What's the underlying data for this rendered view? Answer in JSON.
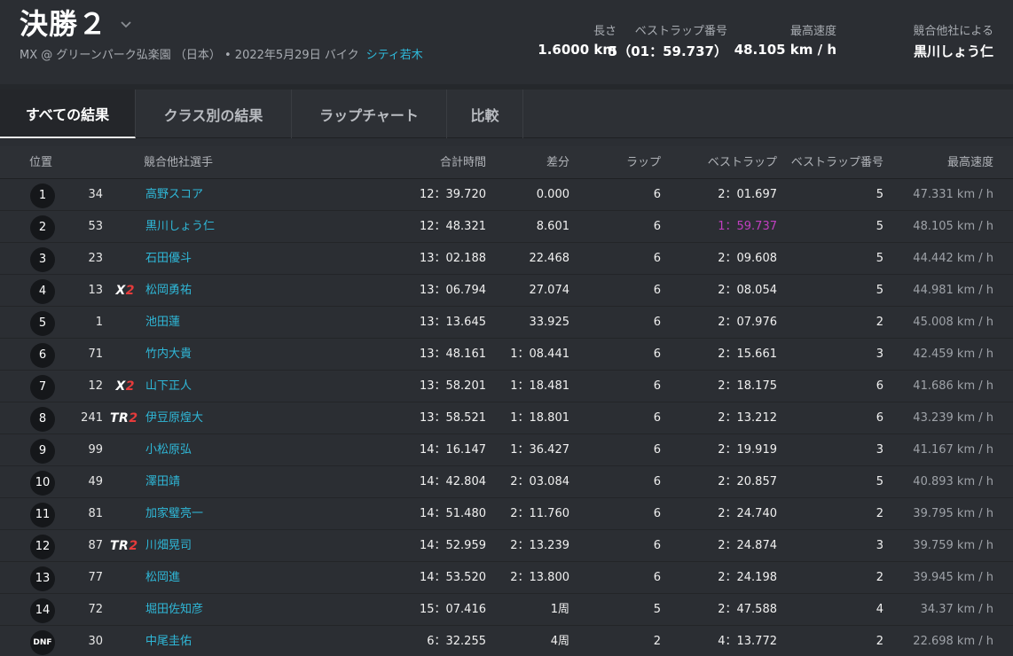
{
  "header": {
    "title": "決勝２",
    "subtitle_info": "MX @ グリーンパーク弘楽園 （日本） • 2022年5月29日 バイク",
    "subtitle_link": "シティ若木",
    "stats": [
      {
        "label": "長さ",
        "value": "1.6000 km"
      },
      {
        "label": "ベストラップ番号",
        "value": "5（01：59.737）"
      },
      {
        "label": "最高速度",
        "value": "48.105 km / h"
      },
      {
        "label": "競合他社による",
        "value": "黒川しょう仁"
      }
    ]
  },
  "tabs": [
    "すべての結果",
    "クラス別の結果",
    "ラップチャート",
    "比較"
  ],
  "columns": {
    "pos": "位置",
    "rider": "競合他社選手",
    "total": "合計時間",
    "gap": "差分",
    "laps": "ラップ",
    "best": "ベストラップ",
    "best_no": "ベストラップ番号",
    "speed": "最高速度"
  },
  "colors": {
    "accent": "#2fb8d8",
    "best_lap_highlight": "#c03fc0",
    "class_badge_number": "#e63b3b"
  },
  "rows": [
    {
      "pos": "1",
      "num": "34",
      "cls": "",
      "cls_n": "",
      "name": "高野スコア",
      "total": "12：39.720",
      "gap": "0.000",
      "laps": "6",
      "best": "2：01.697",
      "best_no": "5",
      "speed": "47.331 km / h"
    },
    {
      "pos": "2",
      "num": "53",
      "cls": "",
      "cls_n": "",
      "name": "黒川しょう仁",
      "total": "12：48.321",
      "gap": "8.601",
      "laps": "6",
      "best": "1：59.737",
      "best_no": "5",
      "speed": "48.105 km / h"
    },
    {
      "pos": "3",
      "num": "23",
      "cls": "",
      "cls_n": "",
      "name": "石田優斗",
      "total": "13：02.188",
      "gap": "22.468",
      "laps": "6",
      "best": "2：09.608",
      "best_no": "5",
      "speed": "44.442 km / h"
    },
    {
      "pos": "4",
      "num": "13",
      "cls": "X",
      "cls_n": "2",
      "name": "松岡勇祐",
      "total": "13：06.794",
      "gap": "27.074",
      "laps": "6",
      "best": "2：08.054",
      "best_no": "5",
      "speed": "44.981 km / h"
    },
    {
      "pos": "5",
      "num": "1",
      "cls": "",
      "cls_n": "",
      "name": "池田蓮",
      "total": "13：13.645",
      "gap": "33.925",
      "laps": "6",
      "best": "2：07.976",
      "best_no": "2",
      "speed": "45.008 km / h"
    },
    {
      "pos": "6",
      "num": "71",
      "cls": "",
      "cls_n": "",
      "name": "竹内大貴",
      "total": "13：48.161",
      "gap": "1：08.441",
      "laps": "6",
      "best": "2：15.661",
      "best_no": "3",
      "speed": "42.459 km / h"
    },
    {
      "pos": "7",
      "num": "12",
      "cls": "X",
      "cls_n": "2",
      "name": "山下正人",
      "total": "13：58.201",
      "gap": "1：18.481",
      "laps": "6",
      "best": "2：18.175",
      "best_no": "6",
      "speed": "41.686 km / h"
    },
    {
      "pos": "8",
      "num": "241",
      "cls": "TR",
      "cls_n": "2",
      "name": "伊豆原煌大",
      "total": "13：58.521",
      "gap": "1：18.801",
      "laps": "6",
      "best": "2：13.212",
      "best_no": "6",
      "speed": "43.239 km / h"
    },
    {
      "pos": "9",
      "num": "99",
      "cls": "",
      "cls_n": "",
      "name": "小松原弘",
      "total": "14：16.147",
      "gap": "1：36.427",
      "laps": "6",
      "best": "2：19.919",
      "best_no": "3",
      "speed": "41.167 km / h"
    },
    {
      "pos": "10",
      "num": "49",
      "cls": "",
      "cls_n": "",
      "name": "澤田靖",
      "total": "14：42.804",
      "gap": "2：03.084",
      "laps": "6",
      "best": "2：20.857",
      "best_no": "5",
      "speed": "40.893 km / h"
    },
    {
      "pos": "11",
      "num": "81",
      "cls": "",
      "cls_n": "",
      "name": "加家璧亮一",
      "total": "14：51.480",
      "gap": "2：11.760",
      "laps": "6",
      "best": "2：24.740",
      "best_no": "2",
      "speed": "39.795 km / h"
    },
    {
      "pos": "12",
      "num": "87",
      "cls": "TR",
      "cls_n": "2",
      "name": "川畑晃司",
      "total": "14：52.959",
      "gap": "2：13.239",
      "laps": "6",
      "best": "2：24.874",
      "best_no": "3",
      "speed": "39.759 km / h"
    },
    {
      "pos": "13",
      "num": "77",
      "cls": "",
      "cls_n": "",
      "name": "松岡進",
      "total": "14：53.520",
      "gap": "2：13.800",
      "laps": "6",
      "best": "2：24.198",
      "best_no": "2",
      "speed": "39.945 km / h"
    },
    {
      "pos": "14",
      "num": "72",
      "cls": "",
      "cls_n": "",
      "name": "堀田佐知彦",
      "total": "15：07.416",
      "gap": "1周",
      "laps": "5",
      "best": "2：47.588",
      "best_no": "4",
      "speed": "34.37 km / h"
    },
    {
      "pos": "DNF",
      "num": "30",
      "cls": "",
      "cls_n": "",
      "name": "中尾圭佑",
      "total": "6：32.255",
      "gap": "4周",
      "laps": "2",
      "best": "4：13.772",
      "best_no": "2",
      "speed": "22.698 km / h"
    }
  ],
  "best_overall_row": 1
}
